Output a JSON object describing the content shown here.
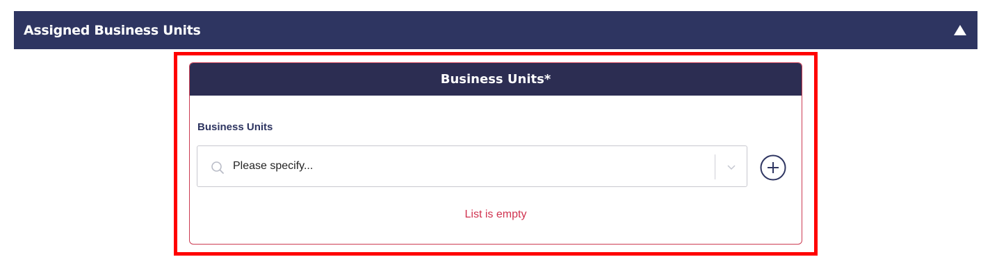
{
  "section": {
    "title": "Assigned Business Units"
  },
  "card": {
    "title": "Business Units*",
    "field_label": "Business Units",
    "select_placeholder": "Please specify...",
    "empty_message": "List is empty"
  },
  "icons": {
    "collapse": "triangle-up-icon",
    "search": "search-icon",
    "dropdown": "chevron-down-icon",
    "add": "plus-circle-icon"
  },
  "colors": {
    "header_bg": "#2e3561",
    "card_header_bg": "#2c2d52",
    "highlight": "#ff0000",
    "error_text": "#d0324f",
    "card_border": "#cc3b52"
  }
}
